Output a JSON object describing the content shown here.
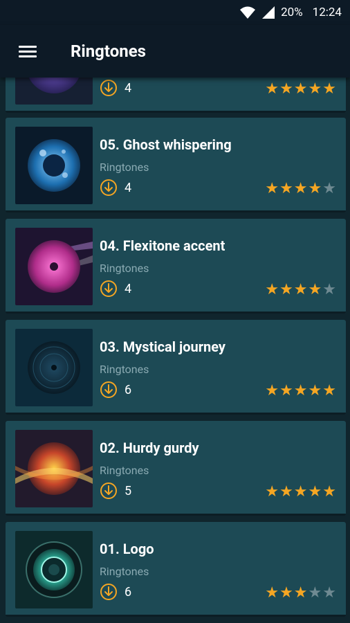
{
  "status": {
    "battery": "20%",
    "time": "12:24"
  },
  "header": {
    "title": "Ringtones"
  },
  "items": [
    {
      "title": "",
      "category": "",
      "downloads": "4",
      "rating": 5
    },
    {
      "title": "05. Ghost whispering",
      "category": "Ringtones",
      "downloads": "4",
      "rating": 4
    },
    {
      "title": "04. Flexitone accent",
      "category": "Ringtones",
      "downloads": "4",
      "rating": 4
    },
    {
      "title": "03. Mystical journey",
      "category": "Ringtones",
      "downloads": "6",
      "rating": 5
    },
    {
      "title": "02. Hurdy gurdy",
      "category": "Ringtones",
      "downloads": "5",
      "rating": 5
    },
    {
      "title": "01. Logo",
      "category": "Ringtones",
      "downloads": "6",
      "rating": 3
    }
  ],
  "colors": {
    "accent": "#f5a623",
    "card": "#1d4a55",
    "background": "#10252d",
    "toolbar": "#0d1a26"
  }
}
